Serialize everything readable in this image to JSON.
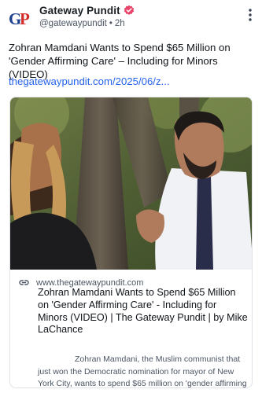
{
  "post": {
    "author_name": "Gateway Pundit",
    "handle": "@gatewaypundit",
    "separator": "•",
    "time_ago": "2h",
    "avatar_text": "GP",
    "text": "Zohran Mamdani Wants to Spend $65 Million on 'Gender Affirming Care' – Including for Minors (VIDEO)",
    "link": "thegatewaypundit.com/2025/06/z..."
  },
  "card": {
    "domain": "www.thegatewaypundit.com",
    "title": "Zohran Mamdani Wants to Spend $65 Million on 'Gender Affirming Care' - Including for Minors (VIDEO) | The Gateway Pundit | by Mike LaChance",
    "description": "Zohran Mamdani, the Muslim communist that just won the Democratic nomination for mayor of New York City, wants to spend $65 million on 'gender affirming care' including for minors."
  },
  "icons": {
    "verified": "verified-badge-icon",
    "more": "more-options-icon",
    "link": "link-icon"
  },
  "colors": {
    "link": "#2563eb",
    "verified": "#e8456b",
    "avatar_blue": "#1d3f8f",
    "avatar_red": "#d42b2b"
  }
}
